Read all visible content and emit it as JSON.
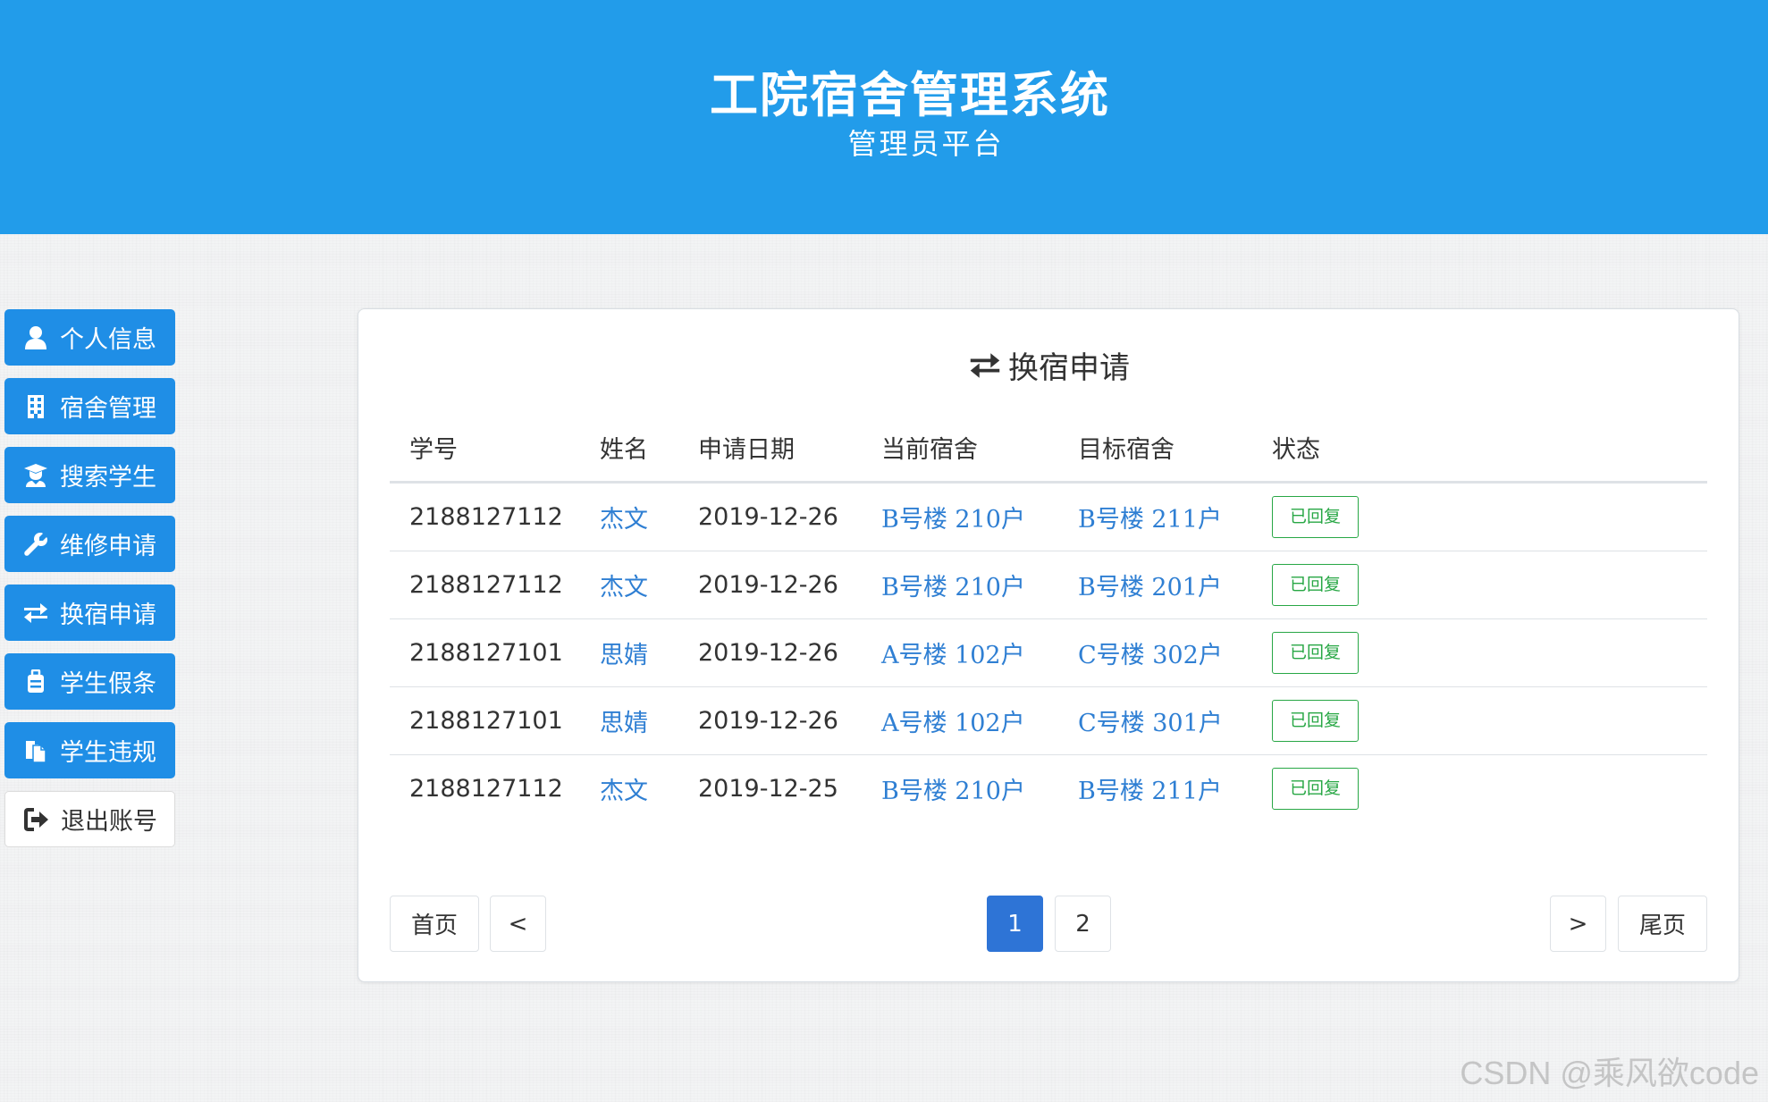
{
  "header": {
    "title": "工院宿舍管理系统",
    "subtitle": "管理员平台"
  },
  "sidebar": {
    "items": [
      {
        "label": "个人信息",
        "icon": "user-icon"
      },
      {
        "label": "宿舍管理",
        "icon": "building-icon"
      },
      {
        "label": "搜索学生",
        "icon": "graduate-icon"
      },
      {
        "label": "维修申请",
        "icon": "wrench-icon"
      },
      {
        "label": "换宿申请",
        "icon": "exchange-icon"
      },
      {
        "label": "学生假条",
        "icon": "luggage-icon"
      },
      {
        "label": "学生违规",
        "icon": "copy-icon"
      },
      {
        "label": "退出账号",
        "icon": "sign-out-icon"
      }
    ]
  },
  "panel": {
    "title": "换宿申请",
    "title_icon": "exchange-icon",
    "columns": [
      "学号",
      "姓名",
      "申请日期",
      "当前宿舍",
      "目标宿舍",
      "状态"
    ],
    "rows": [
      {
        "id": "2188127112",
        "name": "杰文",
        "date": "2019-12-26",
        "current": "B号楼 210户",
        "target": "B号楼 211户",
        "status": "已回复"
      },
      {
        "id": "2188127112",
        "name": "杰文",
        "date": "2019-12-26",
        "current": "B号楼 210户",
        "target": "B号楼 201户",
        "status": "已回复"
      },
      {
        "id": "2188127101",
        "name": "思婧",
        "date": "2019-12-26",
        "current": "A号楼 102户",
        "target": "C号楼 302户",
        "status": "已回复"
      },
      {
        "id": "2188127101",
        "name": "思婧",
        "date": "2019-12-26",
        "current": "A号楼 102户",
        "target": "C号楼 301户",
        "status": "已回复"
      },
      {
        "id": "2188127112",
        "name": "杰文",
        "date": "2019-12-25",
        "current": "B号楼 210户",
        "target": "B号楼 211户",
        "status": "已回复"
      }
    ]
  },
  "pagination": {
    "first": "首页",
    "prev": "<",
    "pages": [
      "1",
      "2"
    ],
    "current_page": "1",
    "next": ">",
    "last": "尾页"
  },
  "watermark": "CSDN @乘风欲code",
  "colors": {
    "header": "#229cea",
    "nav_button": "#1f8ee6",
    "link": "#2f7fd3",
    "status_badge": "#28a745",
    "active_page": "#2e74d6"
  }
}
